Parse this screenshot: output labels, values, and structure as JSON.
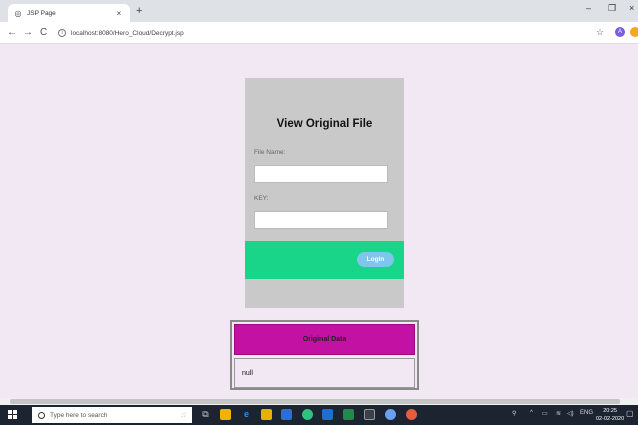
{
  "browser": {
    "tab_title": "JSP Page",
    "tab_close": "×",
    "new_tab": "+",
    "minimize": "–",
    "maximize": "❐",
    "close": "×",
    "back": "←",
    "forward": "→",
    "reload": "C",
    "url": "localhost:8080/Hero_Cloud/Decrypt.jsp",
    "avatar_letter": "A"
  },
  "form": {
    "title": "View Original File",
    "file_name_label": "File Name:",
    "file_name_value": "",
    "key_label": "KEY:",
    "key_value": "",
    "login_label": "Login"
  },
  "result": {
    "header": "Original Data",
    "value": "null"
  },
  "taskbar": {
    "search_placeholder": "Type here to search",
    "language": "ENG",
    "time": "20:25",
    "date": "02-02-2020"
  },
  "colors": {
    "page_bg": "#f2e8f4",
    "card_bg": "#c9c9c9",
    "green_band": "#18d58a",
    "login_button": "#7ec6ec",
    "table_header": "#c211a3"
  }
}
